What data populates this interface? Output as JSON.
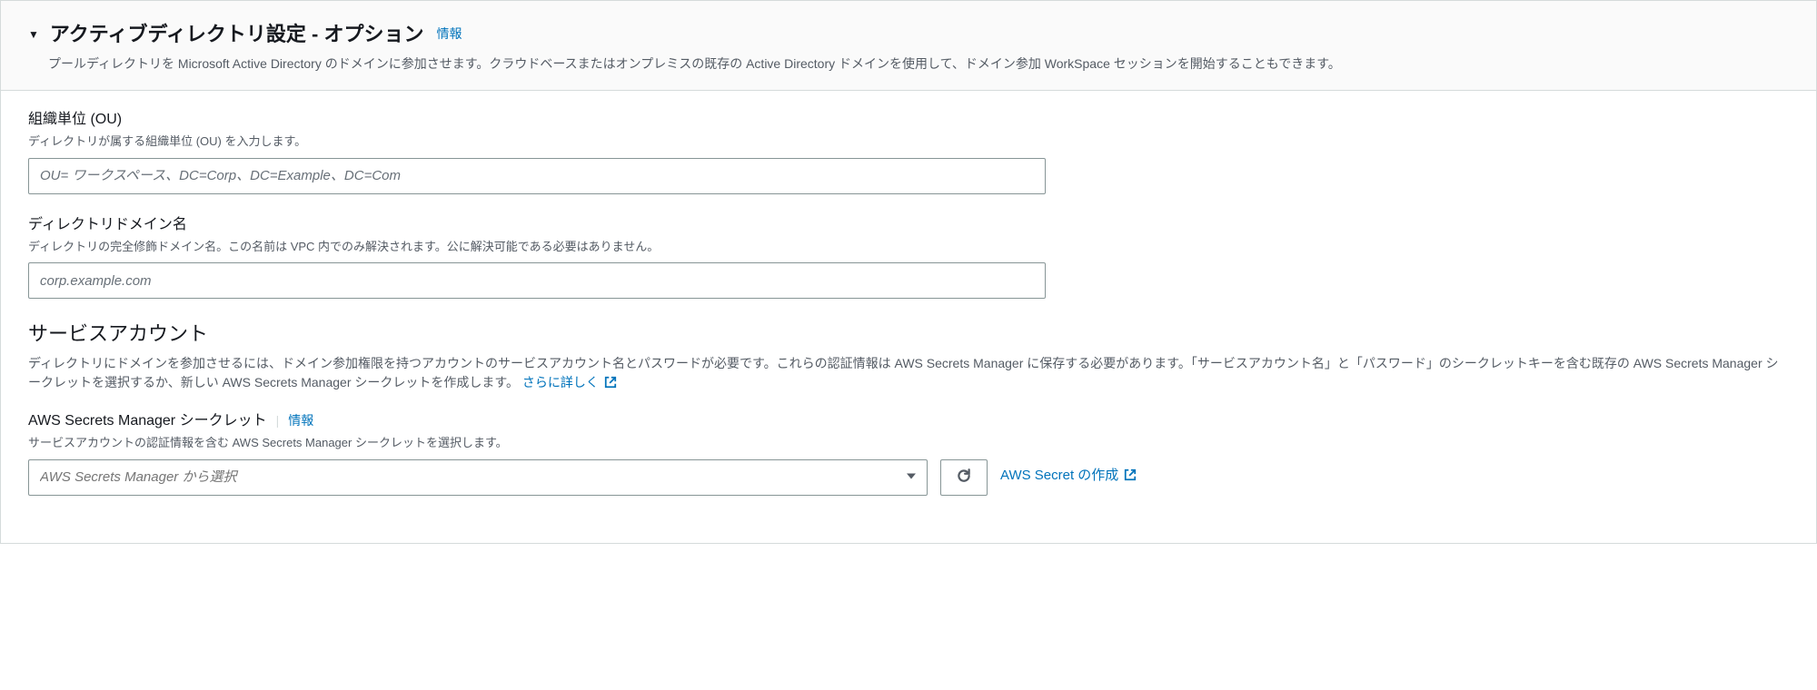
{
  "header": {
    "title": "アクティブディレクトリ設定 - オプション",
    "info": "情報",
    "description": "プールディレクトリを Microsoft Active Directory のドメインに参加させます。クラウドベースまたはオンプレミスの既存の Active Directory ドメインを使用して、ドメイン参加 WorkSpace セッションを開始することもできます。"
  },
  "ou": {
    "label": "組織単位 (OU)",
    "hint": "ディレクトリが属する組織単位 (OU) を入力します。",
    "placeholder": "OU= ワークスペース、DC=Corp、DC=Example、DC=Com",
    "value": ""
  },
  "domain": {
    "label": "ディレクトリドメイン名",
    "hint": "ディレクトリの完全修飾ドメイン名。この名前は VPC 内でのみ解決されます。公に解決可能である必要はありません。",
    "placeholder": "corp.example.com",
    "value": ""
  },
  "service_account": {
    "title": "サービスアカウント",
    "description": "ディレクトリにドメインを参加させるには、ドメイン参加権限を持つアカウントのサービスアカウント名とパスワードが必要です。これらの認証情報は AWS Secrets Manager に保存する必要があります。「サービスアカウント名」と「パスワード」のシークレットキーを含む既存の AWS Secrets Manager シークレットを選択するか、新しい AWS Secrets Manager シークレットを作成します。",
    "learn_more": "さらに詳しく"
  },
  "secret": {
    "label": "AWS Secrets Manager シークレット",
    "info": "情報",
    "hint": "サービスアカウントの認証情報を含む AWS Secrets Manager シークレットを選択します。",
    "placeholder": "AWS Secrets Manager から選択",
    "create_link": "AWS Secret の作成"
  }
}
